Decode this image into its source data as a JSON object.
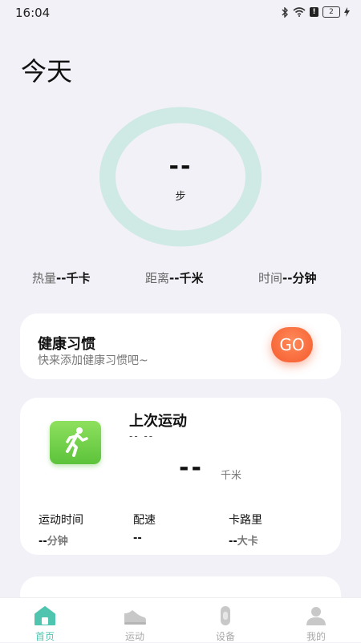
{
  "status_bar": {
    "time": "16:04",
    "battery_level": "2"
  },
  "page_title": "今天",
  "steps": {
    "value": "--",
    "unit": "步"
  },
  "stats": [
    {
      "label": "热量",
      "value": "--千卡"
    },
    {
      "label": "距离",
      "value": "--千米"
    },
    {
      "label": "时间",
      "value": "--分钟"
    }
  ],
  "habit_card": {
    "title": "健康习惯",
    "subtitle": "快来添加健康习惯吧~",
    "go_label": "GO"
  },
  "last_sport": {
    "title": "上次运动",
    "date": "-- --",
    "distance_value": "--",
    "distance_unit": "千米",
    "metrics": [
      {
        "label": "运动时间",
        "value": "--",
        "unit": "分钟"
      },
      {
        "label": "配速",
        "value": "--",
        "unit": ""
      },
      {
        "label": "卡路里",
        "value": "--",
        "unit": "大卡"
      }
    ]
  },
  "tabs": [
    {
      "label": "首页",
      "icon": "home-icon",
      "active": true
    },
    {
      "label": "运动",
      "icon": "shoe-icon",
      "active": false
    },
    {
      "label": "设备",
      "icon": "band-icon",
      "active": false
    },
    {
      "label": "我的",
      "icon": "user-icon",
      "active": false
    }
  ],
  "colors": {
    "accent": "#4fc5b0",
    "ring": "#cfe9e4",
    "go_button": "#f55a2c",
    "run_icon": "#6cc94a"
  }
}
